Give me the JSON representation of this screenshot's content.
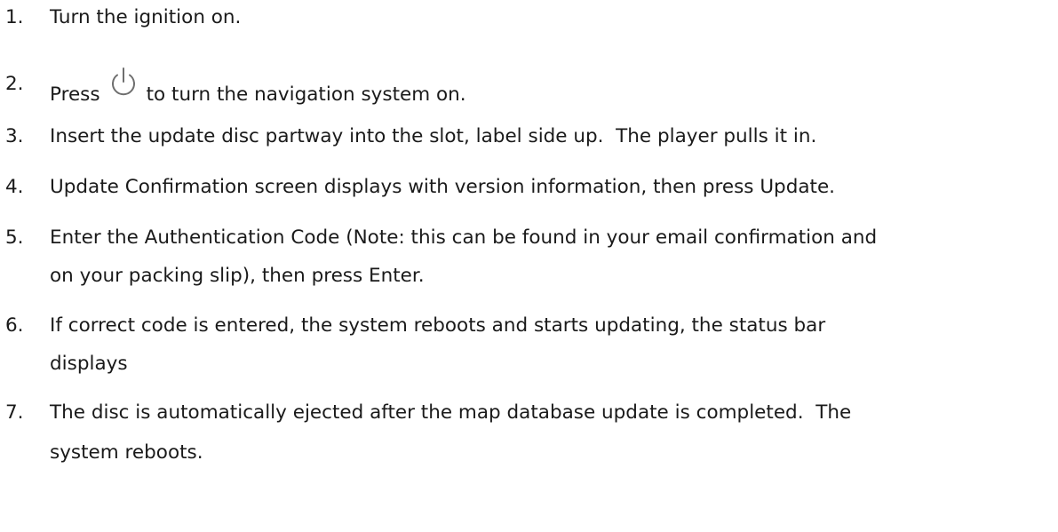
{
  "steps": [
    {
      "num": "1.",
      "text": "Turn the ignition on."
    },
    {
      "num": "2.",
      "before": "Press",
      "icon": "power-icon",
      "after": "to turn the navigation system on."
    },
    {
      "num": "3.",
      "text": "Insert the update disc partway into the slot, label side up.  The player pulls it in."
    },
    {
      "num": "4.",
      "text": "Update Confirmation screen displays with version information, then press Update."
    },
    {
      "num": "5.",
      "lines": [
        "Enter the Authentication Code (Note: this can be found in your email confirmation and",
        "on your packing slip), then press Enter."
      ]
    },
    {
      "num": "6.",
      "lines": [
        "If correct code is entered, the system reboots and starts updating, the status bar",
        "displays"
      ]
    },
    {
      "num": "7.",
      "lines": [
        "The disc is automatically ejected after the map database update is completed.  The",
        "system reboots."
      ]
    }
  ]
}
